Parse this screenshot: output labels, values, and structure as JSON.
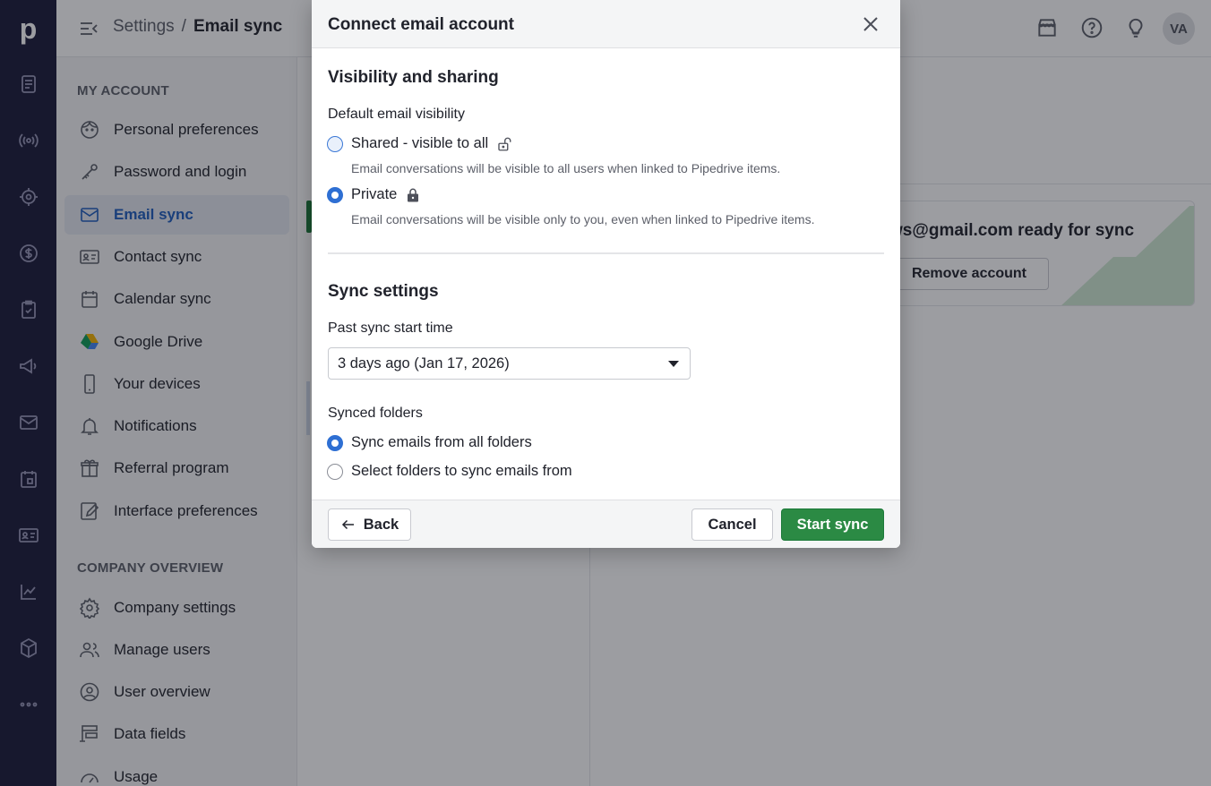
{
  "rail": {
    "logo": "p",
    "items": [
      "deals-icon",
      "leads-icon",
      "target-icon",
      "dollar-icon",
      "tasks-icon",
      "campaigns-icon",
      "mail-icon",
      "calendar-icon",
      "contacts-icon",
      "insights-icon",
      "products-icon",
      "more-icon"
    ]
  },
  "topbar": {
    "breadcrumb_root": "Settings",
    "breadcrumb_sep": "/",
    "breadcrumb_current": "Email sync",
    "avatar_initials": "VA"
  },
  "sidebar": {
    "my_account_title": "MY ACCOUNT",
    "my_account_items": [
      {
        "label": "Personal preferences",
        "icon": "face-icon"
      },
      {
        "label": "Password and login",
        "icon": "key-icon"
      },
      {
        "label": "Email sync",
        "icon": "mail-icon"
      },
      {
        "label": "Contact sync",
        "icon": "contact-card-icon"
      },
      {
        "label": "Calendar sync",
        "icon": "calendar-icon"
      },
      {
        "label": "Google Drive",
        "icon": "google-drive-icon"
      },
      {
        "label": "Your devices",
        "icon": "phone-icon"
      },
      {
        "label": "Notifications",
        "icon": "bell-icon"
      },
      {
        "label": "Referral program",
        "icon": "gift-icon"
      },
      {
        "label": "Interface preferences",
        "icon": "interface-edit-icon"
      }
    ],
    "company_title": "COMPANY OVERVIEW",
    "company_items": [
      {
        "label": "Company settings",
        "icon": "gear-icon"
      },
      {
        "label": "Manage users",
        "icon": "users-icon"
      },
      {
        "label": "User overview",
        "icon": "user-circle-icon"
      },
      {
        "label": "Data fields",
        "icon": "data-fields-icon"
      },
      {
        "label": "Usage",
        "icon": "gauge-icon"
      }
    ]
  },
  "background": {
    "account_text": "ws@gmail.com ready for sync",
    "remove_account_label": "Remove account"
  },
  "modal": {
    "title": "Connect email account",
    "visibility_heading": "Visibility and sharing",
    "default_visibility_label": "Default email visibility",
    "option_shared_label": "Shared - visible to all",
    "option_shared_desc": "Email conversations will be visible to all users when linked to Pipedrive items.",
    "option_private_label": "Private",
    "option_private_desc": "Email conversations will be visible only to you, even when linked to Pipedrive items.",
    "selected_visibility": "Private",
    "sync_heading": "Sync settings",
    "past_sync_label": "Past sync start time",
    "past_sync_value": "3 days ago (Jan 17, 2026)",
    "synced_folders_label": "Synced folders",
    "folders_all_label": "Sync emails from all folders",
    "folders_select_label": "Select folders to sync emails from",
    "selected_folders": "Sync emails from all folders",
    "back_label": "Back",
    "cancel_label": "Cancel",
    "start_label": "Start sync"
  },
  "colors": {
    "rail_bg": "#1b1a3a",
    "primary_blue": "#2e6fd3",
    "start_green": "#2b8a44"
  }
}
